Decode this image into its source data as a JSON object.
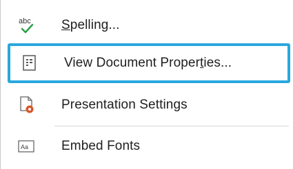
{
  "menu": {
    "items": [
      {
        "label_pre": "",
        "label_ul": "S",
        "label_post": "pelling...",
        "icon": "spelling-abc-check-icon",
        "icon_text": "abc"
      },
      {
        "label_pre": "View Document Proper",
        "label_ul": "t",
        "label_post": "ies...",
        "icon": "document-properties-icon"
      },
      {
        "label_pre": "Presentation Settings",
        "label_ul": "",
        "label_post": "",
        "icon": "presentation-settings-icon"
      },
      {
        "label_pre": "Embed Fonts",
        "label_ul": "",
        "label_post": "",
        "icon": "embed-fonts-icon",
        "icon_text": "Aa"
      }
    ]
  },
  "colors": {
    "focus_border": "#2aa7de",
    "check_green": "#2e9f4b",
    "gear_orange": "#d8572a"
  }
}
